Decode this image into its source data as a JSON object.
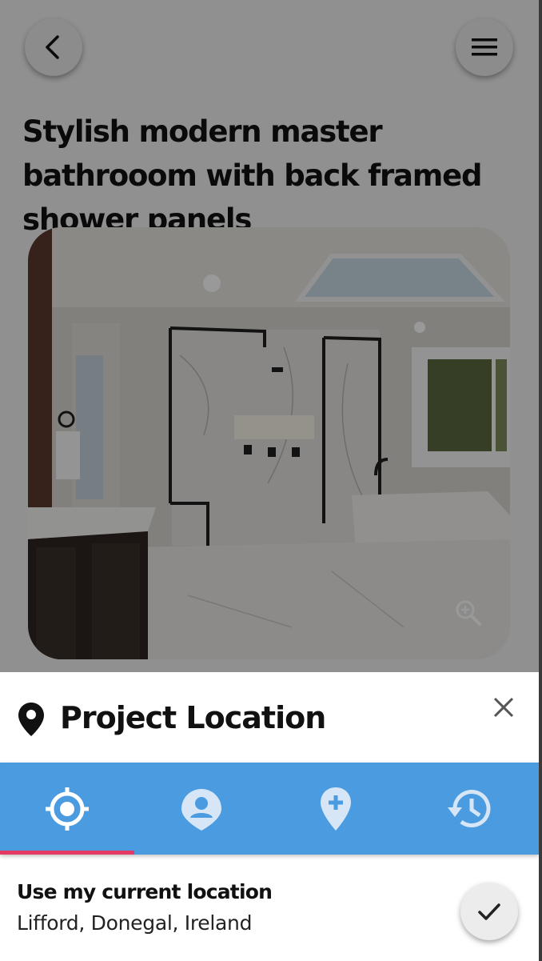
{
  "project": {
    "title": "Stylish modern master bathrooom with back framed shower panels"
  },
  "header_icons": {
    "back": "chevron-left-icon",
    "menu": "hamburger-menu-icon"
  },
  "photo": {
    "zoom_icon": "zoom-in-icon"
  },
  "sheet": {
    "title": "Project Location",
    "title_icon": "map-pin-icon",
    "close_icon": "close-icon",
    "tabs": [
      {
        "icon": "gps-crosshair-icon",
        "active": true
      },
      {
        "icon": "user-pin-icon",
        "active": false
      },
      {
        "icon": "add-pin-icon",
        "active": false
      },
      {
        "icon": "history-icon",
        "active": false
      }
    ],
    "option": {
      "title": "Use my current location",
      "subtitle": "Lifford, Donegal, Ireland",
      "confirm_icon": "check-icon"
    }
  },
  "colors": {
    "tabbar": "#4a9be0",
    "indicator": "#e23a63"
  }
}
